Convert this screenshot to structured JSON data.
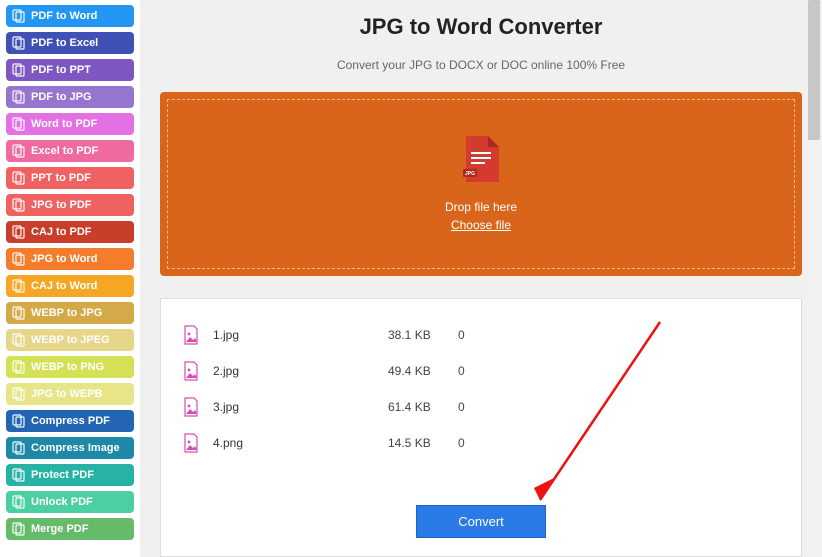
{
  "sidebar": {
    "items": [
      {
        "label": "PDF to Word",
        "bg": "#2196f3"
      },
      {
        "label": "PDF to Excel",
        "bg": "#3f51b5"
      },
      {
        "label": "PDF to PPT",
        "bg": "#7e57c2"
      },
      {
        "label": "PDF to JPG",
        "bg": "#9575cd"
      },
      {
        "label": "Word to PDF",
        "bg": "#e471e4"
      },
      {
        "label": "Excel to PDF",
        "bg": "#ef6aa0"
      },
      {
        "label": "PPT to PDF",
        "bg": "#f06262"
      },
      {
        "label": "JPG to PDF",
        "bg": "#f06262"
      },
      {
        "label": "CAJ to PDF",
        "bg": "#c83e2a"
      },
      {
        "label": "JPG to Word",
        "bg": "#f57c2a"
      },
      {
        "label": "CAJ to Word",
        "bg": "#f5a623"
      },
      {
        "label": "WEBP to JPG",
        "bg": "#d4a947"
      },
      {
        "label": "WEBP to JPEG",
        "bg": "#e6d68a"
      },
      {
        "label": "WEBP to PNG",
        "bg": "#d4e157"
      },
      {
        "label": "JPG to WEPB",
        "bg": "#e8e589"
      },
      {
        "label": "Compress PDF",
        "bg": "#2465b3"
      },
      {
        "label": "Compress Image",
        "bg": "#1e88a8"
      },
      {
        "label": "Protect PDF",
        "bg": "#26b3a6"
      },
      {
        "label": "Unlock PDF",
        "bg": "#4dd0a1"
      },
      {
        "label": "Merge PDF",
        "bg": "#66bb6a"
      }
    ]
  },
  "header": {
    "title": "JPG to Word Converter",
    "subtitle": "Convert your JPG to DOCX or DOC online 100% Free"
  },
  "dropzone": {
    "file_badge": "JPG",
    "drop_text": "Drop file here",
    "choose_text": "Choose file"
  },
  "files": [
    {
      "name": "1.jpg",
      "size": "38.1 KB",
      "pages": "0"
    },
    {
      "name": "2.jpg",
      "size": "49.4 KB",
      "pages": "0"
    },
    {
      "name": "3.jpg",
      "size": "61.4 KB",
      "pages": "0"
    },
    {
      "name": "4.png",
      "size": "14.5 KB",
      "pages": "0"
    }
  ],
  "actions": {
    "convert": "Convert"
  }
}
